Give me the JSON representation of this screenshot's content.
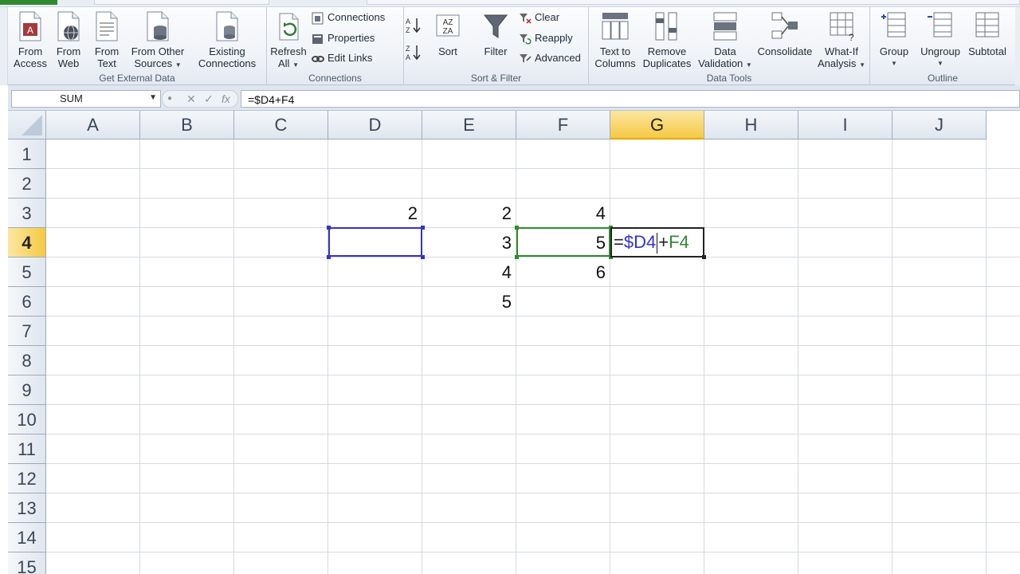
{
  "ribbon": {
    "get_external_data": {
      "label": "Get External Data",
      "buttons": [
        {
          "id": "from-access",
          "line1": "From",
          "line2": "Access"
        },
        {
          "id": "from-web",
          "line1": "From",
          "line2": "Web"
        },
        {
          "id": "from-text",
          "line1": "From",
          "line2": "Text"
        },
        {
          "id": "from-other-sources",
          "line1": "From Other",
          "line2": "Sources"
        },
        {
          "id": "existing-connections",
          "line1": "Existing",
          "line2": "Connections"
        }
      ]
    },
    "connections": {
      "label": "Connections",
      "refresh_line1": "Refresh",
      "refresh_line2": "All",
      "connections_label": "Connections",
      "properties_label": "Properties",
      "edit_links_label": "Edit Links"
    },
    "sort_filter": {
      "label": "Sort & Filter",
      "sort_label": "Sort",
      "sort_az": "AZ",
      "sort_za": "ZA",
      "filter_label": "Filter",
      "clear_label": "Clear",
      "reapply_label": "Reapply",
      "advanced_label": "Advanced"
    },
    "data_tools": {
      "label": "Data Tools",
      "buttons": [
        {
          "id": "text-to-columns",
          "line1": "Text to",
          "line2": "Columns"
        },
        {
          "id": "remove-duplicates",
          "line1": "Remove",
          "line2": "Duplicates"
        },
        {
          "id": "data-validation",
          "line1": "Data",
          "line2": "Validation"
        },
        {
          "id": "consolidate",
          "line1": "Consolidate",
          "line2": ""
        },
        {
          "id": "what-if-analysis",
          "line1": "What-If",
          "line2": "Analysis"
        }
      ]
    },
    "outline": {
      "label": "Outline",
      "buttons": [
        {
          "id": "group",
          "line1": "Group"
        },
        {
          "id": "ungroup",
          "line1": "Ungroup"
        },
        {
          "id": "subtotal",
          "line1": "Subtotal"
        }
      ]
    }
  },
  "formula_bar": {
    "name_box": "SUM",
    "cancel_symbol": "✕",
    "enter_symbol": "✓",
    "fx_symbol": "fx",
    "formula": "=$D4+F4"
  },
  "sheet": {
    "columns": [
      "A",
      "B",
      "C",
      "D",
      "E",
      "F",
      "G",
      "H",
      "I",
      "J"
    ],
    "active_column": "G",
    "rows": [
      "1",
      "2",
      "3",
      "4",
      "5",
      "6",
      "7",
      "8",
      "9",
      "10",
      "11",
      "12",
      "13",
      "14",
      "15"
    ],
    "active_row": "4",
    "cells": {
      "D3": "2",
      "E3": "2",
      "F3": "4",
      "E4": "3",
      "F4": "5",
      "E5": "4",
      "F5": "6",
      "E6": "5"
    },
    "active_cell": {
      "ref": "G4",
      "part_eq": "=",
      "part_ref1": "$D4",
      "part_plus": "+",
      "part_ref2": "F4"
    },
    "colors": {
      "ref1": "#3333cc",
      "ref2": "#2e8b2e",
      "active_header": "#f5c943"
    }
  }
}
